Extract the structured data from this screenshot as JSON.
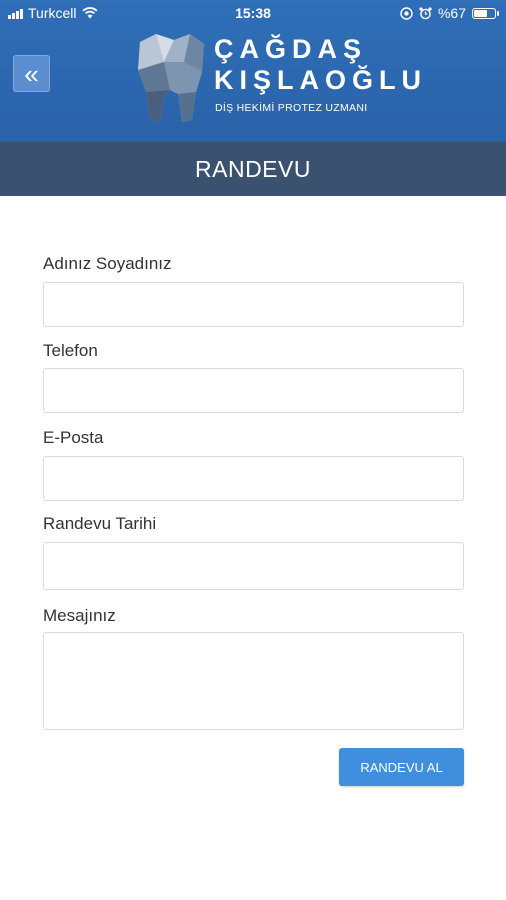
{
  "status_bar": {
    "carrier": "Turkcell",
    "time": "15:38",
    "battery_percent": "%67",
    "battery_level": 0.67
  },
  "header": {
    "back_icon": "double-chevron-left-icon",
    "logo_name_line1": "ÇAĞDAŞ",
    "logo_name_line2": "KIŞLAOĞLU",
    "logo_subtitle": "DİŞ HEKİMİ PROTEZ UZMANI",
    "colors": {
      "header_bg": "#2f6fb8",
      "title_bar_bg": "#3b5170",
      "button_bg": "#3f8fde"
    }
  },
  "page_title": "RANDEVU",
  "form": {
    "fields": [
      {
        "label": "Adınız Soyadınız",
        "value": ""
      },
      {
        "label": "Telefon",
        "value": ""
      },
      {
        "label": "E-Posta",
        "value": ""
      },
      {
        "label": "Randevu Tarihi",
        "value": ""
      },
      {
        "label": "Mesajınız",
        "value": ""
      }
    ],
    "submit_label": "RANDEVU AL"
  }
}
